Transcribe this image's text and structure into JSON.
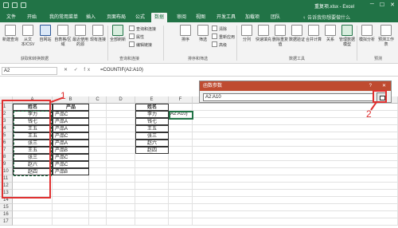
{
  "window": {
    "title": "重复项.xlsx - Excel",
    "controls": [
      "─",
      "☐",
      "✕"
    ]
  },
  "tabs": [
    {
      "label": "文件"
    },
    {
      "label": "开始"
    },
    {
      "label": "我的常用菜单"
    },
    {
      "label": "插入"
    },
    {
      "label": "页面布局"
    },
    {
      "label": "公式"
    },
    {
      "label": "数据",
      "active": true
    },
    {
      "label": "审阅"
    },
    {
      "label": "视图"
    },
    {
      "label": "开发工具"
    },
    {
      "label": "加载项"
    },
    {
      "label": "团队"
    }
  ],
  "tell_me": "♀ 告诉我你想要做什么",
  "ribbon": {
    "buttons": [
      {
        "label": "新建查询"
      },
      {
        "label": "从文本/CSV"
      },
      {
        "label": "自网站"
      },
      {
        "label": "自表格/区域"
      },
      {
        "label": "最近使用的源"
      },
      {
        "label": "现有连接"
      },
      {
        "label": "全部刷新"
      },
      {
        "label": "排序"
      },
      {
        "label": "筛选"
      },
      {
        "label": "分列"
      },
      {
        "label": "快速填充"
      },
      {
        "label": "删除重复值"
      },
      {
        "label": "数据验证"
      },
      {
        "label": "合并计算"
      },
      {
        "label": "关系"
      },
      {
        "label": "管理数据模型"
      },
      {
        "label": "模拟分析"
      },
      {
        "label": "预测工作表"
      }
    ],
    "small_items": [
      "查询和连接",
      "属性",
      "编辑链接",
      "清除",
      "重新应用",
      "高级"
    ],
    "groups": [
      "获取和转换数据",
      "查询和连接",
      "排序和筛选",
      "数据工具",
      "预测"
    ]
  },
  "formula_bar": {
    "name_box": "A2",
    "fx": "✕ ✓ fx",
    "formula": "=COUNTIF(A2:A10)"
  },
  "grid": {
    "columns": [
      "A",
      "B",
      "C",
      "D",
      "E",
      "F"
    ],
    "rows": [
      "1",
      "2",
      "3",
      "4",
      "5",
      "6",
      "7",
      "8",
      "9",
      "10",
      "11",
      "12",
      "13",
      "14",
      "15",
      "16",
      "17"
    ],
    "colA": [
      "姓名",
      "李力",
      "钱七",
      "王五",
      "王五",
      "张三",
      "王五",
      "张三",
      "赵六",
      "赵四"
    ],
    "colB": [
      "产品",
      "产品C",
      "产品A",
      "产品A",
      "产品C",
      "产品A",
      "产品B",
      "产品C",
      "产品C",
      "产品B"
    ],
    "colE": [
      "姓名",
      "李力",
      "钱七",
      "王五",
      "张三",
      "赵六",
      "赵四"
    ],
    "f2": "A2:A10)"
  },
  "dialog": {
    "title": "函数参数",
    "help": "?",
    "close": "✕",
    "input_value": "A2:A10"
  },
  "annotations": [
    "1",
    "2"
  ],
  "colors": {
    "excel_green": "#217346",
    "dialog_title": "#bf4b30",
    "annotation_red": "#e03030"
  }
}
